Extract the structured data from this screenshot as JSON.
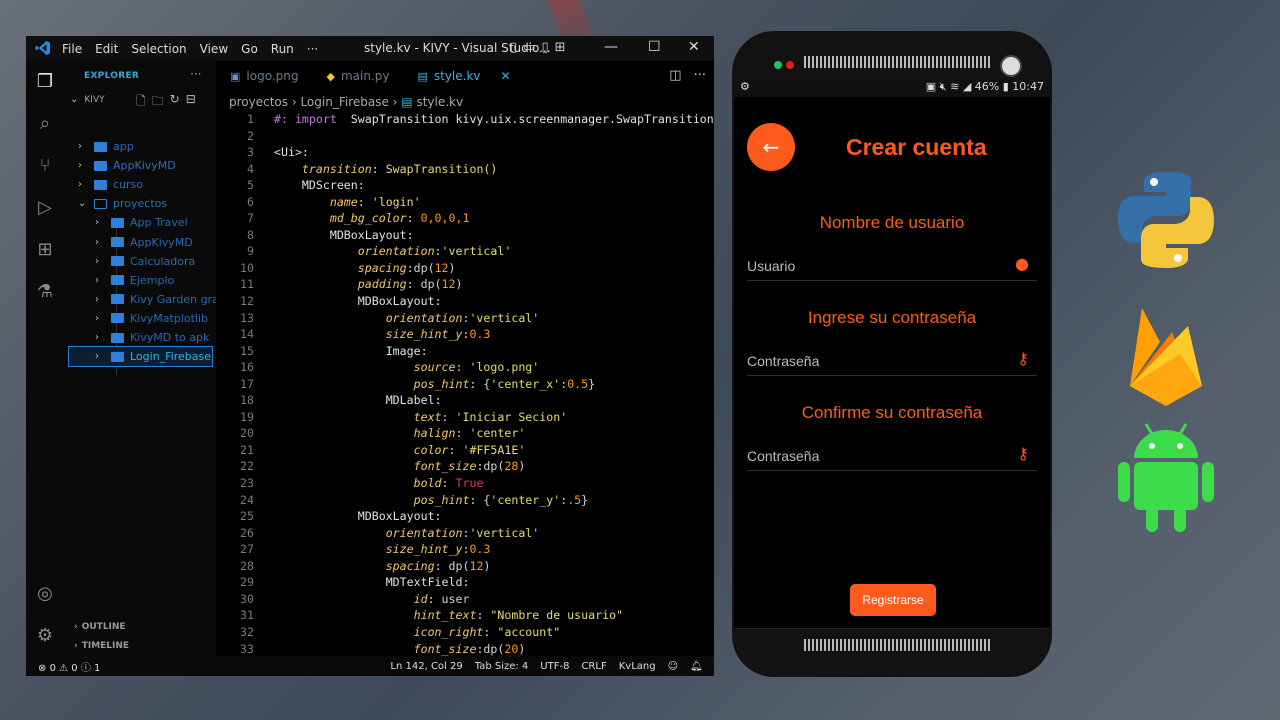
{
  "vscode": {
    "menu": [
      "File",
      "Edit",
      "Selection",
      "View",
      "Go",
      "Run",
      "···"
    ],
    "window_title": "style.kv - KIVY - Visual Studio...",
    "explorer_header": "EXPLORER",
    "explorer_more": "···",
    "root": "KIVY",
    "tree": [
      {
        "label": "app",
        "open": false,
        "sub": false
      },
      {
        "label": "AppKivyMD",
        "open": false,
        "sub": false
      },
      {
        "label": "curso",
        "open": false,
        "sub": false
      },
      {
        "label": "proyectos",
        "open": true,
        "sub": false
      },
      {
        "label": "App Travel",
        "open": false,
        "sub": true
      },
      {
        "label": "AppKivyMD",
        "open": false,
        "sub": true
      },
      {
        "label": "Calculadora",
        "open": false,
        "sub": true
      },
      {
        "label": "Ejemplo",
        "open": false,
        "sub": true
      },
      {
        "label": "Kivy Garden graph",
        "open": false,
        "sub": true
      },
      {
        "label": "KivyMatplotlib",
        "open": false,
        "sub": true
      },
      {
        "label": "KivyMD to apk",
        "open": false,
        "sub": true
      },
      {
        "label": "Login_Firebase",
        "open": false,
        "sub": true,
        "selected": true
      }
    ],
    "outline": "OUTLINE",
    "timeline": "TIMELINE",
    "tabs": [
      {
        "label": "logo.png",
        "icon": "image-icon",
        "active": false
      },
      {
        "label": "main.py",
        "icon": "python-icon",
        "active": false
      },
      {
        "label": "style.kv",
        "icon": "file-icon",
        "active": true
      }
    ],
    "breadcrumb": [
      "proyectos",
      "Login_Firebase",
      "style.kv"
    ],
    "status": {
      "errors": "0",
      "warnings": "0",
      "info": "1",
      "position": "Ln 142, Col 29",
      "tab_size": "Tab Size: 4",
      "encoding": "UTF-8",
      "eol": "CRLF",
      "language": "KvLang"
    }
  },
  "code_lines": [
    "<span class='p'>#: import</span>  <span class='cls'>SwapTransition kivy.uix.screenmanager.SwapTransition</span>",
    "",
    "<span class='cls'>&lt;Ui&gt;:</span>",
    "    <span class='k'>transition</span>: <span class='f'>SwapTransition()</span>",
    "    <span class='cls'>MDScreen:</span>",
    "        <span class='k'>name</span>: <span class='s'>'login'</span>",
    "        <span class='k'>md_bg_color</span>: <span class='n'>0,0,0,1</span>",
    "        <span class='cls'>MDBoxLayout:</span>",
    "            <span class='k'>orientation</span>:<span class='s'>'vertical'</span>",
    "            <span class='k'>spacing</span>:dp(<span class='n'>12</span>)",
    "            <span class='k'>padding</span>: dp(<span class='n'>12</span>)",
    "            <span class='cls'>MDBoxLayout:</span>",
    "                <span class='k'>orientation</span>:<span class='s'>'vertical'</span>",
    "                <span class='k'>size_hint_y</span>:<span class='n'>0.3</span>",
    "                <span class='cls'>Image:</span>",
    "                    <span class='k'>source</span>: <span class='s'>'logo.png'</span>",
    "                    <span class='k'>pos_hint</span>: {<span class='s'>'center_x'</span>:<span class='n'>0.5</span>}",
    "                <span class='cls'>MDLabel:</span>",
    "                    <span class='k'>text</span>: <span class='s'>'Iniciar Secion'</span>",
    "                    <span class='k'>halign</span>: <span class='s'>'center'</span>",
    "                    <span class='k'>color</span>: <span class='s'>'#FF5A1E'</span>",
    "                    <span class='k'>font_size</span>:dp(<span class='n'>28</span>)",
    "                    <span class='k'>bold</span>: <span class='kw'>True</span>",
    "                    <span class='k'>pos_hint</span>: {<span class='s'>'center_y'</span>:<span class='n'>.5</span>}",
    "            <span class='cls'>MDBoxLayout:</span>",
    "                <span class='k'>orientation</span>:<span class='s'>'vertical'</span>",
    "                <span class='k'>size_hint_y</span>:<span class='n'>0.3</span>",
    "                <span class='k'>spacing</span>: dp(<span class='n'>12</span>)",
    "                <span class='cls'>MDTextField:</span>",
    "                    <span class='k'>id</span>: user",
    "                    <span class='k'>hint_text</span>: <span class='s'>\"Nombre de usuario\"</span>",
    "                    <span class='k'>icon_right</span>: <span class='s'>\"account\"</span>",
    "                    <span class='k'>font_size</span>:dp(<span class='n'>20</span>)"
  ],
  "phone": {
    "status_left": "⚙",
    "battery": "46%",
    "time": "10:47",
    "title": "Crear cuenta",
    "label_user": "Nombre de usuario",
    "hint_user": "Usuario",
    "label_pass": "Ingrese su contraseña",
    "hint_pass": "Contraseña",
    "label_confirm": "Confirme su contraseña",
    "hint_confirm": "Contraseña",
    "register": "Registrarse",
    "accent": "#FF5A1E"
  }
}
